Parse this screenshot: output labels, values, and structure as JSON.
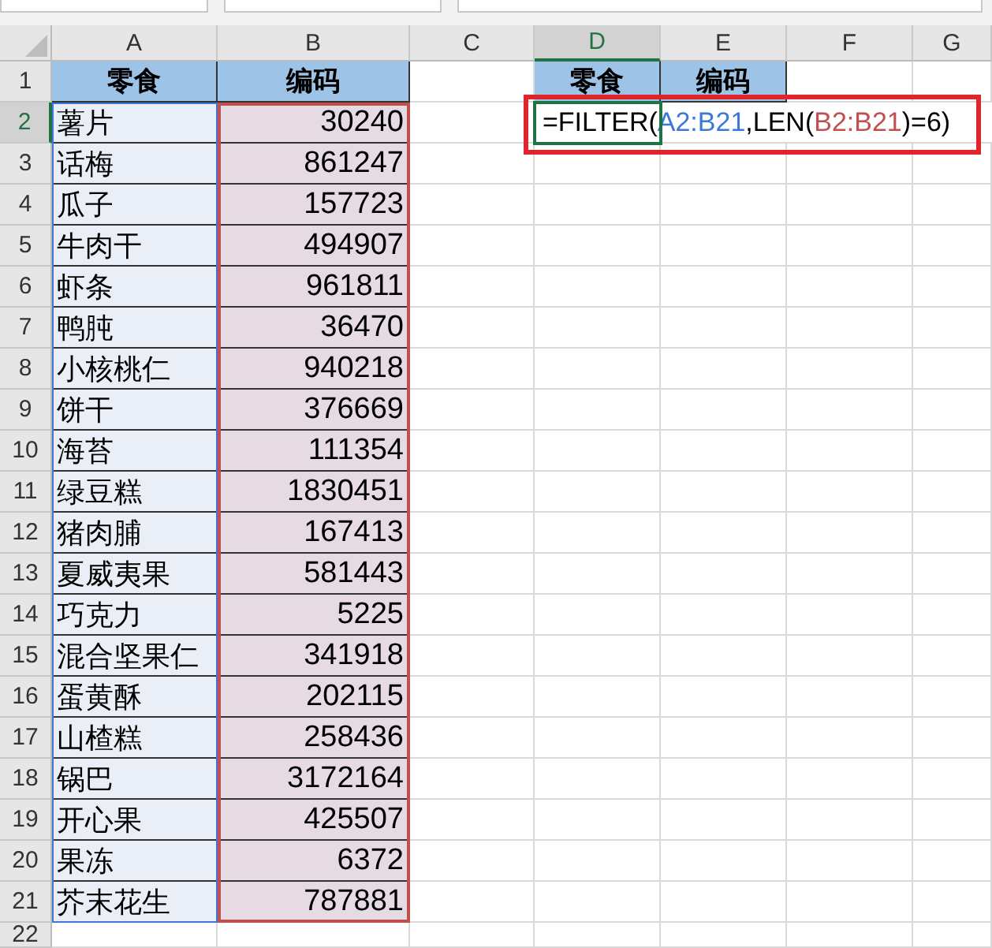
{
  "columns": [
    {
      "label": "A",
      "selected": false
    },
    {
      "label": "B",
      "selected": false
    },
    {
      "label": "C",
      "selected": false
    },
    {
      "label": "D",
      "selected": true
    },
    {
      "label": "E",
      "selected": false
    },
    {
      "label": "F",
      "selected": false
    },
    {
      "label": "G",
      "selected": false
    }
  ],
  "row_numbers": [
    {
      "label": "1",
      "selected": false
    },
    {
      "label": "2",
      "selected": true
    },
    {
      "label": "3",
      "selected": false
    },
    {
      "label": "4",
      "selected": false
    },
    {
      "label": "5",
      "selected": false
    },
    {
      "label": "6",
      "selected": false
    },
    {
      "label": "7",
      "selected": false
    },
    {
      "label": "8",
      "selected": false
    },
    {
      "label": "9",
      "selected": false
    },
    {
      "label": "10",
      "selected": false
    },
    {
      "label": "11",
      "selected": false
    },
    {
      "label": "12",
      "selected": false
    },
    {
      "label": "13",
      "selected": false
    },
    {
      "label": "14",
      "selected": false
    },
    {
      "label": "15",
      "selected": false
    },
    {
      "label": "16",
      "selected": false
    },
    {
      "label": "17",
      "selected": false
    },
    {
      "label": "18",
      "selected": false
    },
    {
      "label": "19",
      "selected": false
    },
    {
      "label": "20",
      "selected": false
    },
    {
      "label": "21",
      "selected": false
    },
    {
      "label": "22",
      "selected": false
    }
  ],
  "table": {
    "headers": [
      "零食",
      "编码"
    ],
    "rows": [
      [
        "薯片",
        "30240"
      ],
      [
        "话梅",
        "861247"
      ],
      [
        "瓜子",
        "157723"
      ],
      [
        "牛肉干",
        "494907"
      ],
      [
        "虾条",
        "961811"
      ],
      [
        "鸭肫",
        "36470"
      ],
      [
        "小核桃仁",
        "940218"
      ],
      [
        "饼干",
        "376669"
      ],
      [
        "海苔",
        "111354"
      ],
      [
        "绿豆糕",
        "1830451"
      ],
      [
        "猪肉脯",
        "167413"
      ],
      [
        "夏威夷果",
        "581443"
      ],
      [
        "巧克力",
        "5225"
      ],
      [
        "混合坚果仁",
        "341918"
      ],
      [
        "蛋黄酥",
        "202115"
      ],
      [
        "山楂糕",
        "258436"
      ],
      [
        "锅巴",
        "3172164"
      ],
      [
        "开心果",
        "425507"
      ],
      [
        "果冻",
        "6372"
      ],
      [
        "芥末花生",
        "787881"
      ]
    ]
  },
  "output_headers": [
    "零食",
    "编码"
  ],
  "formula": {
    "parts": [
      {
        "text": "=FILTER(",
        "color": "#000000"
      },
      {
        "text": "A2:B21",
        "color": "#3c78d8"
      },
      {
        "text": ",LEN(",
        "color": "#000000"
      },
      {
        "text": "B2:B21",
        "color": "#c0504d"
      },
      {
        "text": ")=6)",
        "color": "#000000"
      }
    ]
  }
}
